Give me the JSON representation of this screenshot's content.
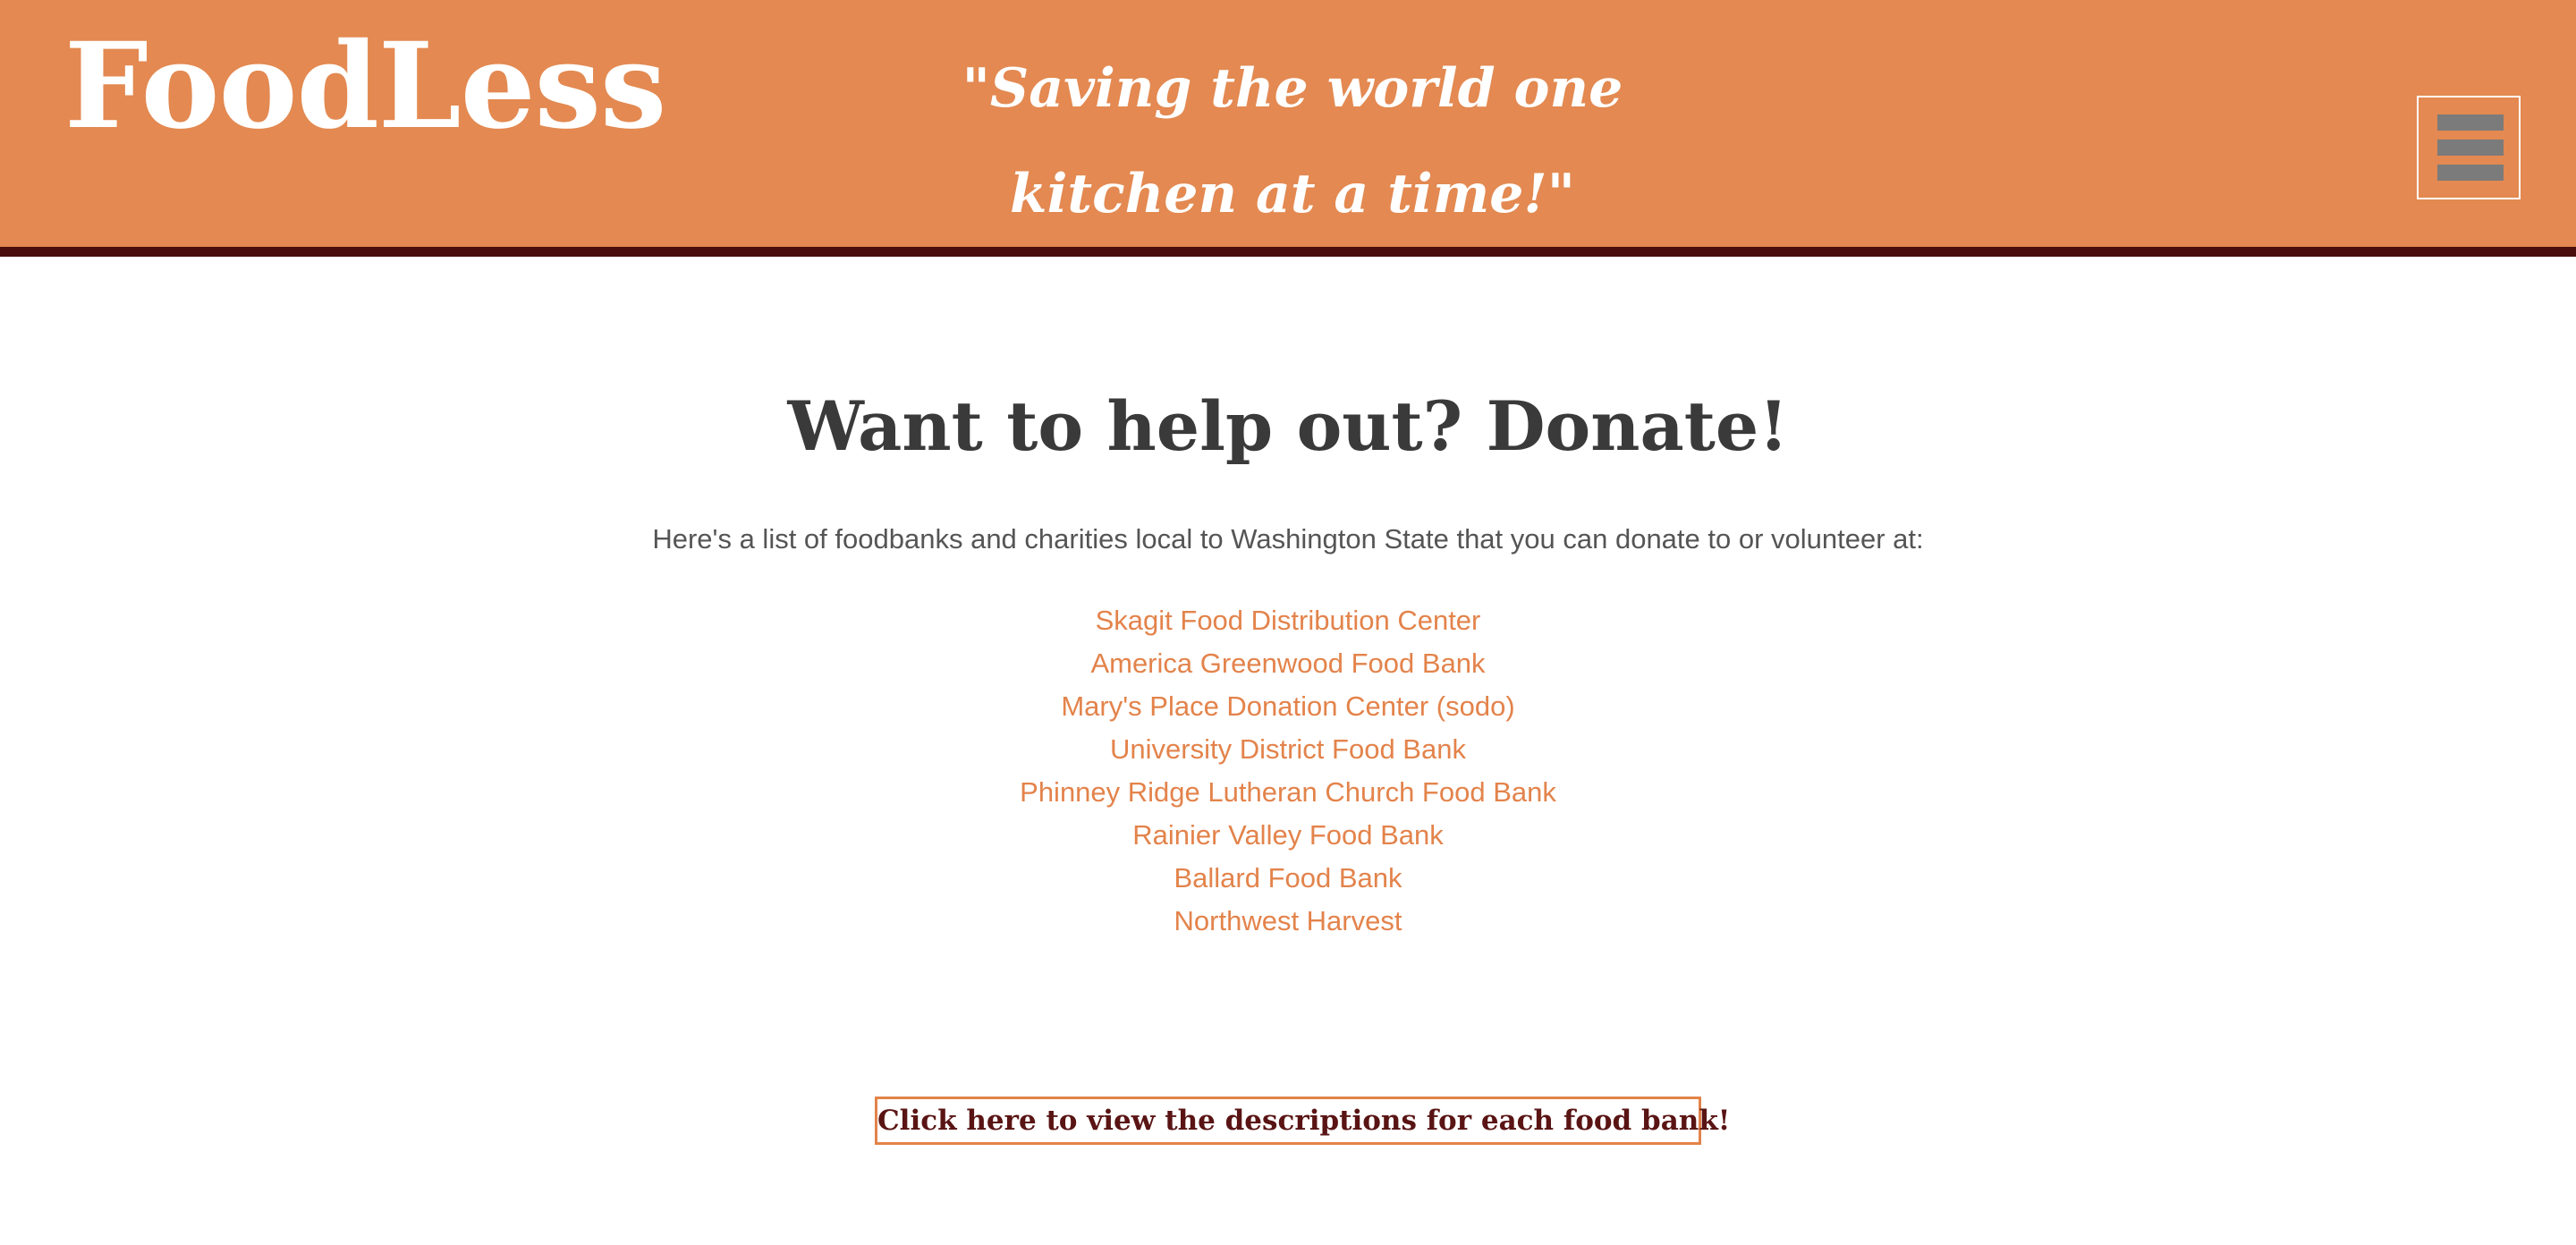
{
  "header": {
    "logo_text": "FoodLess",
    "tagline": "\"Saving the world one kitchen at a time!\"",
    "menu_icon": "hamburger-menu-icon"
  },
  "main": {
    "heading": "Want to help out? Donate!",
    "intro": "Here's a list of foodbanks and charities local to Washington State that you can donate to or volunteer at:",
    "food_banks": [
      "Skagit Food Distribution Center",
      "America Greenwood Food Bank",
      "Mary's Place Donation Center (sodo)",
      "University District Food Bank",
      "Phinney Ridge Lutheran Church Food Bank",
      "Rainier Valley Food Bank",
      "Ballard Food Bank",
      "Northwest Harvest"
    ],
    "descriptions_button_label": "Click here to view the descriptions for each food bank!"
  },
  "colors": {
    "header_background": "#e38951",
    "header_border": "#4a0f0c",
    "link": "#e3834b",
    "heading_text": "#3a3a3a",
    "button_text": "#5a1414"
  }
}
